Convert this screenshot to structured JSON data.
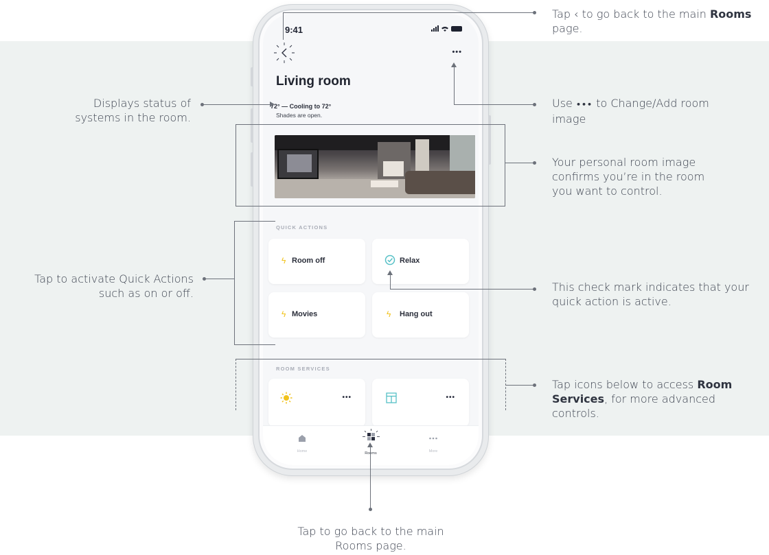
{
  "phone": {
    "status_time": "9:41",
    "room_title": "Living room",
    "room_status": "72° — Cooling to 72°",
    "room_sub": "Shades are open.",
    "more_label": "•••",
    "quick_actions_label": "QUICK ACTIONS",
    "quick_actions": [
      {
        "label": "Room off",
        "icon": "bolt-icon",
        "active": false
      },
      {
        "label": "Relax",
        "icon": "check-circle-icon",
        "active": true
      },
      {
        "label": "Movies",
        "icon": "bolt-icon",
        "active": false
      },
      {
        "label": "Hang out",
        "icon": "bolt-icon",
        "active": false
      }
    ],
    "room_services_label": "ROOM SERVICES",
    "room_services": [
      {
        "icon": "sun-icon",
        "more": "•••"
      },
      {
        "icon": "shades-icon",
        "more": "•••"
      }
    ],
    "tabs": [
      {
        "label": "Home",
        "icon": "home-icon"
      },
      {
        "label": "Rooms",
        "icon": "rooms-grid-icon"
      },
      {
        "label": "More",
        "icon": "more-icon"
      }
    ]
  },
  "annotations": {
    "back_pre": "Tap ",
    "back_glyph": "‹",
    "back_mid": " to go back to the main ",
    "back_bold": "Rooms",
    "back_post": " page.",
    "more_pre": "Use ",
    "more_glyph": "•••",
    "more_post": " to Change/Add room image",
    "status": "Displays status of systems in the room.",
    "image": "Your personal room image confirms you’re in the room you want to control.",
    "quick": "Tap to activate Quick Actions such as on or off.",
    "check": "This check mark indicates that your quick action is active.",
    "services_pre": "Tap icons below to access ",
    "services_bold": "Room Services",
    "services_post": ", for more advanced controls.",
    "rooms_tab": "Tap to go back to the main Rooms page."
  },
  "colors": {
    "band": "#eef2f1",
    "accent_bolt": "#f1c21b",
    "accent_check": "#56c0c6",
    "line": "#6c717a"
  }
}
